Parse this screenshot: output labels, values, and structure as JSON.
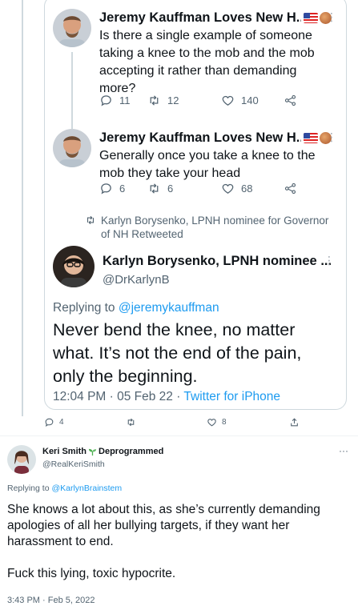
{
  "quoted_thread": {
    "tweets": [
      {
        "name": "Jeremy Kauffman Loves New H...",
        "text": "Is there a single example of someone taking a knee to the mob and the mob accepting it rather than demanding more?",
        "replies": "11",
        "retweets": "12",
        "likes": "140"
      },
      {
        "name": "Jeremy Kauffman Loves New H...",
        "text": "Generally once you take a knee to the mob they take your head",
        "replies": "6",
        "retweets": "6",
        "likes": "68"
      }
    ],
    "retweet_label": "Karlyn Borysenko, LPNH nominee for Governor of NH Retweeted",
    "main_tweet": {
      "name": "Karlyn Borysenko, LPNH nominee ...",
      "handle": "@DrKarlynB",
      "replying_prefix": "Replying to",
      "replying_to": "@jeremykauffman",
      "text": "Never bend the knee, no matter what. It’s not the end of the pain, only the beginning.",
      "time": "12:04 PM · 05 Feb 22 ·",
      "source": "Twitter for iPhone"
    }
  },
  "outer_actions": {
    "replies": "4",
    "likes": "8"
  },
  "reply": {
    "name": "Keri Smith",
    "name_suffix": "Deprogrammed",
    "handle": "@RealKeriSmith",
    "replying_prefix": "Replying to",
    "replying_to": "@KarlynBrainstem",
    "paragraph_1": "She knows a lot about this, as she’s currently demanding apologies of all her bullying targets, if they want her harassment to end.",
    "paragraph_2": "Fuck this lying, toxic hypocrite.",
    "time": "3:43 PM · Feb 5, 2022"
  },
  "icons": {
    "reply": "reply-icon",
    "retweet": "retweet-icon",
    "like": "heart-icon",
    "share": "share-icon",
    "more": "more-icon",
    "sprout": "sprout-icon",
    "flag": "us-flag-icon"
  },
  "colors": {
    "link": "#1d9bf0",
    "muted": "#536471",
    "border": "#cfd9de",
    "text": "#0f1419",
    "sprout": "#4caf50"
  }
}
